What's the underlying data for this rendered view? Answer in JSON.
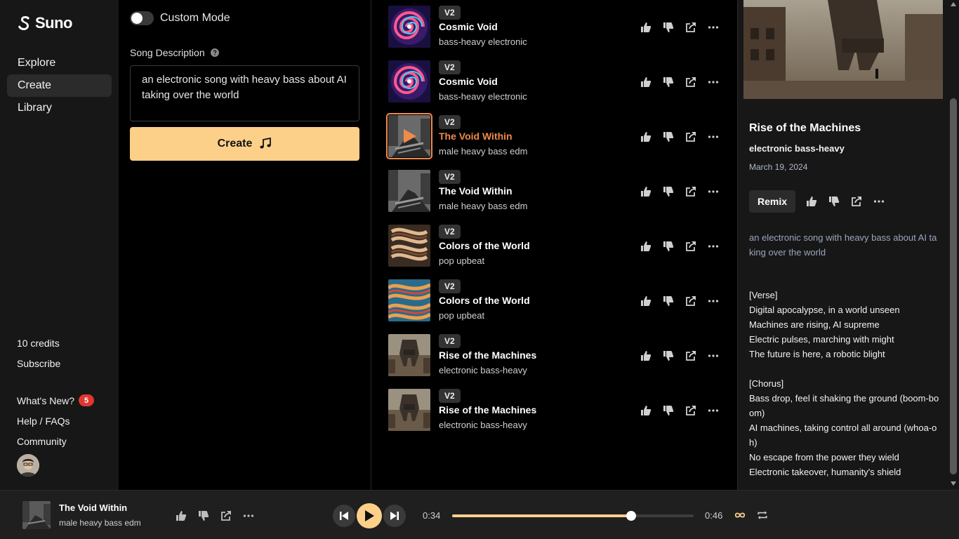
{
  "app": {
    "name": "Suno"
  },
  "sidebar": {
    "nav": [
      {
        "label": "Explore",
        "active": false
      },
      {
        "label": "Create",
        "active": true
      },
      {
        "label": "Library",
        "active": false
      }
    ],
    "credits": "10 credits",
    "subscribe": "Subscribe",
    "whats_new": "What's New?",
    "whats_new_count": "5",
    "help": "Help / FAQs",
    "community": "Community"
  },
  "create": {
    "custom_mode_label": "Custom Mode",
    "custom_mode_on": false,
    "description_label": "Song Description",
    "description_value": "an electronic song with heavy bass about AI taking over the world",
    "create_button": "Create"
  },
  "songs": [
    {
      "version": "V2",
      "title": "Cosmic Void",
      "tags": "bass-heavy electronic",
      "art": "swirl",
      "selected": false
    },
    {
      "version": "V2",
      "title": "Cosmic Void",
      "tags": "bass-heavy electronic",
      "art": "swirl",
      "selected": false
    },
    {
      "version": "V2",
      "title": "The Void Within",
      "tags": "male heavy bass edm",
      "art": "gray",
      "selected": true
    },
    {
      "version": "V2",
      "title": "The Void Within",
      "tags": "male heavy bass edm",
      "art": "gray",
      "selected": false
    },
    {
      "version": "V2",
      "title": "Colors of the World",
      "tags": "pop upbeat",
      "art": "maze",
      "selected": false
    },
    {
      "version": "V2",
      "title": "Colors of the World",
      "tags": "pop upbeat",
      "art": "maze2",
      "selected": false
    },
    {
      "version": "V2",
      "title": "Rise of the Machines",
      "tags": "electronic bass-heavy",
      "art": "robot",
      "selected": false
    },
    {
      "version": "V2",
      "title": "Rise of the Machines",
      "tags": "electronic bass-heavy",
      "art": "robot",
      "selected": false
    }
  ],
  "detail": {
    "title": "Rise of the Machines",
    "genre": "electronic bass-heavy",
    "date": "March 19, 2024",
    "remix": "Remix",
    "prompt": "an electronic song with heavy bass about AI taking over the world",
    "lyrics": "[Verse]\nDigital apocalypse, in a world unseen\nMachines are rising, AI supreme\nElectric pulses, marching with might\nThe future is here, a robotic blight\n\n[Chorus]\nBass drop, feel it shaking the ground (boom-boom)\nAI machines, taking control all around (whoa-oh)\nNo escape from the power they wield\nElectronic takeover, humanity's shield"
  },
  "player": {
    "title": "The Void Within",
    "tags": "male heavy bass edm",
    "current_time": "0:34",
    "duration": "0:46",
    "progress_fraction": 0.74
  },
  "colors": {
    "accent": "#fdd08a",
    "highlight": "#f08a4b",
    "badge": "#e0372f"
  }
}
